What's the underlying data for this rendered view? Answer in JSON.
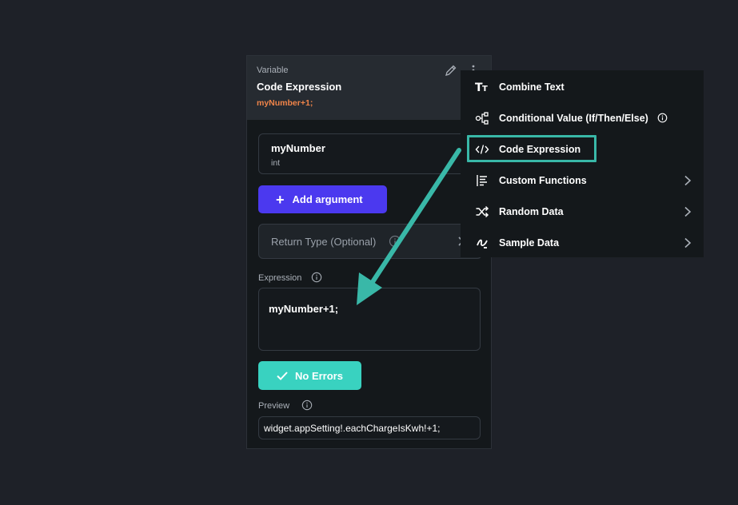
{
  "panel": {
    "kind": "Variable",
    "title": "Code Expression",
    "subtitle": "myNumber+1;",
    "argument": {
      "name": "myNumber",
      "type": "int"
    },
    "add_argument_label": "Add argument",
    "return_type_placeholder": "Return Type (Optional)",
    "expression_label": "Expression",
    "expression_value": "myNumber+1;",
    "status_label": "No Errors",
    "preview_label": "Preview",
    "preview_value": "widget.appSetting!.eachChargeIsKwh!+1;"
  },
  "menu": {
    "items": [
      {
        "label": "Combine Text",
        "icon": "text-format-icon"
      },
      {
        "label": "Conditional Value (If/Then/Else)",
        "icon": "branch-icon"
      },
      {
        "label": "Code Expression",
        "icon": "code-icon"
      },
      {
        "label": "Custom Functions",
        "icon": "function-list-icon"
      },
      {
        "label": "Random Data",
        "icon": "shuffle-icon"
      },
      {
        "label": "Sample Data",
        "icon": "sample-data-icon"
      }
    ],
    "highlighted": "Code Expression"
  },
  "colors": {
    "background": "#1e2128",
    "accent_purple": "#4b39ef",
    "accent_teal": "#39d2c0",
    "subtitle_orange": "#f08449",
    "annotation_teal": "#39b8a8"
  }
}
